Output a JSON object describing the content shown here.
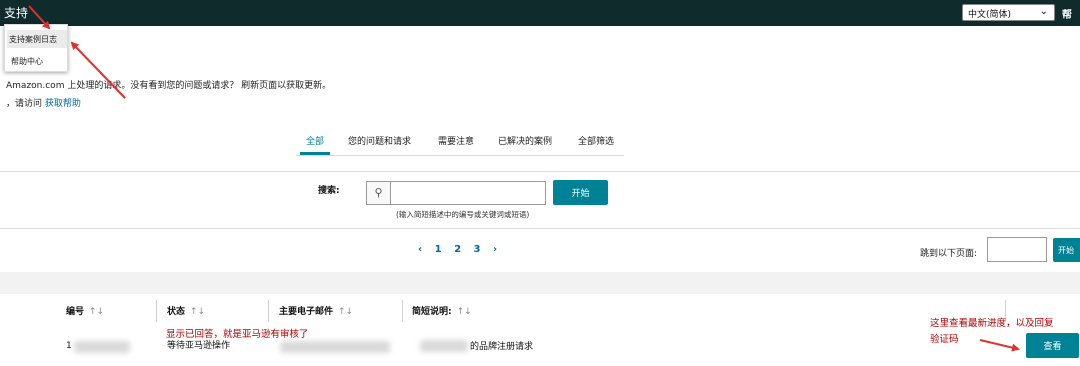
{
  "header": {
    "support_label": "支持",
    "language_selected": "中文(简体)",
    "help_label": "帮"
  },
  "support_menu": {
    "items": [
      "支持案例日志",
      "帮助中心"
    ]
  },
  "intro": {
    "text": "Amazon.com 上处理的请求。没有看到您的问题或请求？ 刷新页面以获取更新。",
    "visit_prefix": "，请访问",
    "visit_link": "获取帮助"
  },
  "tabs": [
    "全部",
    "您的问题和请求",
    "需要注意",
    "已解决的案例",
    "全部筛选"
  ],
  "search": {
    "label": "搜索:",
    "value": "",
    "placeholder": "",
    "button_label": "开始",
    "hint": "(输入简短描述中的编号或关键词或短语)"
  },
  "pagination": {
    "prev": "‹",
    "pages": [
      "1",
      "2",
      "3"
    ],
    "next": "›",
    "jump_label": "跳到以下页面:",
    "jump_value": "",
    "jump_button": "开始"
  },
  "table": {
    "sort_glyph": "↑↓",
    "columns": [
      "编号",
      "状态",
      "主要电子邮件",
      "简短说明:"
    ],
    "rows": [
      {
        "id_prefix": "1",
        "status": "等待亚马逊操作",
        "description_suffix": "的品牌注册请求",
        "action": "查看"
      }
    ]
  },
  "annotations": {
    "note_status": "显示已回答，就是亚马逊有审核了",
    "note_view_line1": "这里查看最新进度，以及回复",
    "note_view_line2": "验证码",
    "color": "#e03030"
  },
  "colors": {
    "topbar": "#0f2b2b",
    "accent": "#008296",
    "link": "#0066a6"
  }
}
